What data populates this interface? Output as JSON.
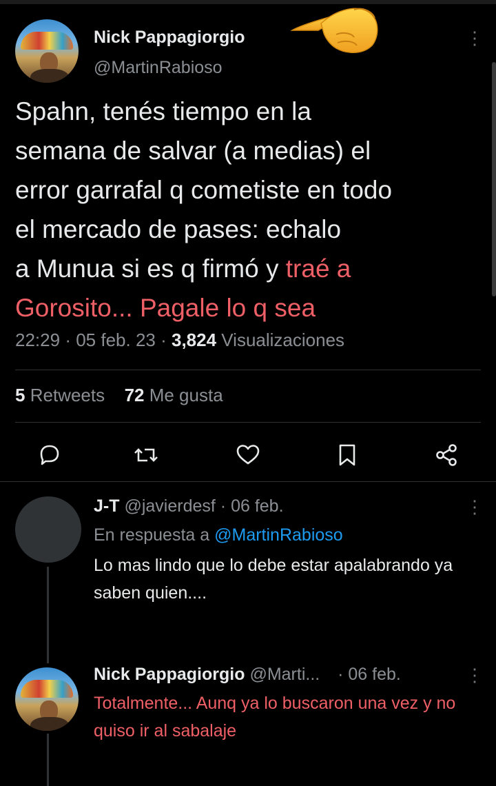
{
  "main_tweet": {
    "author_name": "Nick Pappagiorgio",
    "author_handle": "@MartinRabioso",
    "text_normal": "Spahn, tenés tiempo en la\nsemana de salvar (a medias) el\nerror garrafal q cometiste en todo\nel mercado de pases: echalo\na Munua si es q firmó y ",
    "text_highlight": "traé a\nGorosito... Pagale lo q sea",
    "time": "22:29",
    "date": "05 feb. 23",
    "views_count": "3,824",
    "views_label": "Visualizaciones",
    "retweets_count": "5",
    "retweets_label": "Retweets",
    "likes_count": "72",
    "likes_label": "Me gusta"
  },
  "actions": [
    "reply-icon",
    "retweet-icon",
    "like-icon",
    "bookmark-icon",
    "share-icon"
  ],
  "replies": [
    {
      "author_name": "J-T",
      "author_handle": "@javierdesf",
      "date": "06 feb.",
      "in_reply_prefix": "En respuesta a",
      "in_reply_handle": "@MartinRabioso",
      "text": "Lo mas lindo que lo debe estar apalabrando ya saben quien...."
    },
    {
      "author_name": "Nick Pappagiorgio",
      "author_handle": "@Marti...",
      "date": "06 feb.",
      "text": "Totalmente... Aunq ya lo buscaron una vez y no quiso ir al sabalaje"
    }
  ],
  "colors": {
    "background": "#000000",
    "text": "#e7e9ea",
    "muted": "#8b8f94",
    "highlight_red": "#ef5f66",
    "link_blue": "#1d9bf0",
    "divider": "#2f3336"
  }
}
